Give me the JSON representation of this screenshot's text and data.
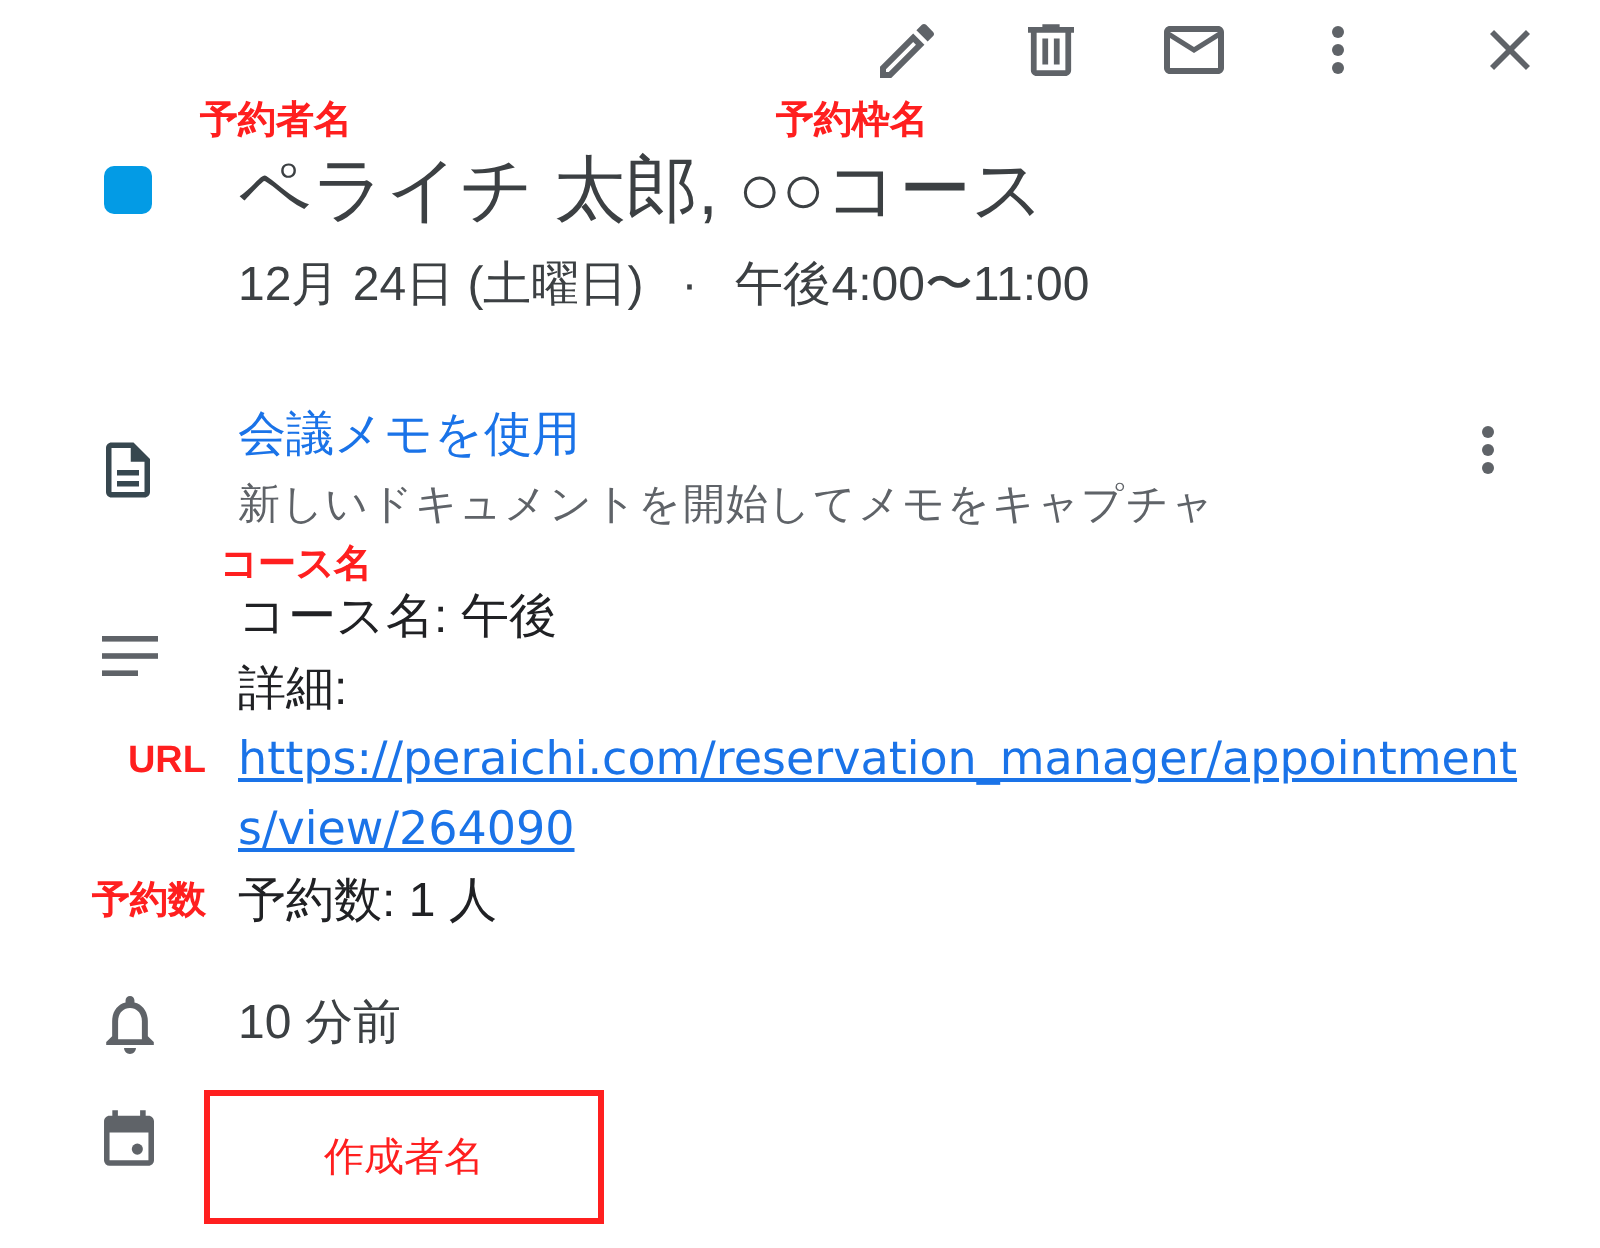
{
  "event": {
    "color": "#039be5",
    "title": "ペライチ 太郎, ○○コース",
    "title_annotations": [
      {
        "text": "予約者名"
      },
      {
        "text": "予約枠名"
      }
    ],
    "date": "12月 24日 (土曜日)",
    "separator": "·",
    "time": "午後4:00〜11:00"
  },
  "meeting_notes": {
    "link": "会議メモを使用",
    "description": "新しいドキュメントを開始してメモをキャプチャ"
  },
  "description": {
    "lines": [
      {
        "kind": "text",
        "text": "コース名: 午後",
        "annotation": {
          "kind": "above",
          "text": "コース名"
        }
      },
      {
        "kind": "text",
        "text": "詳細:"
      },
      {
        "kind": "link",
        "text": "https://peraichi.com/reservation_manager/appointments/view/264090",
        "annotation": {
          "kind": "left",
          "text": "URL"
        }
      },
      {
        "kind": "text",
        "text": "予約数: 1 人",
        "annotation": {
          "kind": "left",
          "text": "予約数"
        }
      }
    ]
  },
  "reminder": {
    "text": "10 分前"
  },
  "organizer": {
    "annotation": "作成者名"
  }
}
